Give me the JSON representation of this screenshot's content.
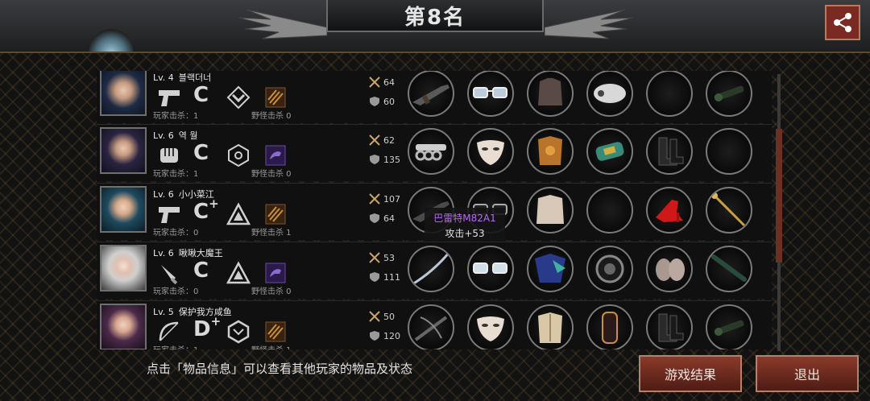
{
  "header": {
    "rank_title": "第8名"
  },
  "hint_text": "点击「物品信息」可以查看其他玩家的物品及状态",
  "buttons": {
    "game_result": "游戏结果",
    "exit": "退出"
  },
  "tooltip": {
    "item_name": "巴雷特M82A1",
    "item_stat": "攻击+53"
  },
  "players": [
    {
      "level": "Lv. 4",
      "name": "블랙더너",
      "grade": "C",
      "grade_plus": "",
      "attack": "64",
      "defense": "60",
      "player_kills": "玩家击杀：1",
      "monster_kills": "野怪击杀 0",
      "weapon_icon": "pistol-icon",
      "skill_icon": "chevron-emblem-icon",
      "buff_icon": "claw-buff-icon",
      "items": [
        "sniper-rifle",
        "glasses",
        "leather-armor",
        "arm-guard",
        "empty",
        "scope"
      ]
    },
    {
      "level": "Lv. 6",
      "name": "역 월",
      "grade": "C",
      "grade_plus": "",
      "attack": "62",
      "defense": "135",
      "player_kills": "玩家击杀：1",
      "monster_kills": "野怪击杀 0",
      "weapon_icon": "fist-icon",
      "skill_icon": "hexagon-emblem-icon",
      "buff_icon": "panther-buff-icon",
      "items": [
        "brass-knuckles",
        "mask",
        "golden-armor",
        "bracelet",
        "boots",
        "empty"
      ]
    },
    {
      "level": "Lv. 6",
      "name": "小小菜江",
      "grade": "C",
      "grade_plus": "+",
      "attack": "107",
      "defense": "64",
      "player_kills": "玩家击杀：0",
      "monster_kills": "野怪击杀 1",
      "weapon_icon": "pistol-icon",
      "skill_icon": "triangle-emblem-icon",
      "buff_icon": "claw-buff-icon",
      "items": [
        "sniper-rifle",
        "glasses",
        "robe",
        "empty",
        "red-heels",
        "golden-staff"
      ]
    },
    {
      "level": "Lv. 6",
      "name": "啾啾大魔王",
      "grade": "C",
      "grade_plus": "",
      "attack": "53",
      "defense": "111",
      "player_kills": "玩家击杀：0",
      "monster_kills": "野怪击杀 0",
      "weapon_icon": "knife-icon",
      "skill_icon": "triangle-emblem-icon",
      "buff_icon": "panther-buff-icon",
      "items": [
        "katana",
        "glasses",
        "dragon-robe",
        "rose-bracelet",
        "slippers",
        "baton"
      ]
    },
    {
      "level": "Lv. 5",
      "name": "保护我方咸鱼",
      "grade": "D",
      "grade_plus": "+",
      "attack": "50",
      "defense": "120",
      "player_kills": "玩家击杀：1",
      "monster_kills": "野怪击杀 1",
      "weapon_icon": "bow-icon",
      "skill_icon": "hexagon-outline-icon",
      "buff_icon": "claw-buff-icon",
      "items": [
        "crossbow",
        "mask",
        "plate-armor",
        "bracer",
        "boots",
        "scope"
      ]
    }
  ]
}
